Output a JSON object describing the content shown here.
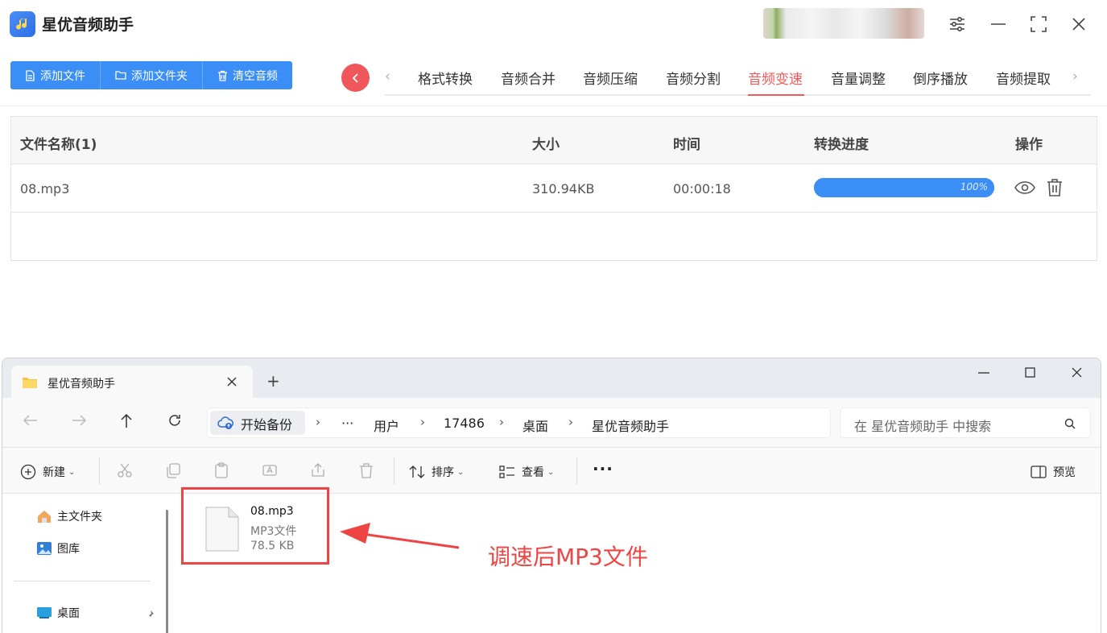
{
  "app": {
    "title": "星优音频助手",
    "accent": "#3a8ef6",
    "tab_accent": "#f05a5a"
  },
  "toolbar": {
    "add_file": "添加文件",
    "add_folder": "添加文件夹",
    "clear": "清空音频"
  },
  "tabs": {
    "items": [
      "格式转换",
      "音频合并",
      "音频压缩",
      "音频分割",
      "音频变速",
      "音量调整",
      "倒序播放",
      "音频提取"
    ],
    "active": "音频变速"
  },
  "table": {
    "headers": {
      "name": "文件名称(1)",
      "size": "大小",
      "time": "时间",
      "progress": "转换进度",
      "action": "操作"
    },
    "rows": [
      {
        "name": "08.mp3",
        "size": "310.94KB",
        "time": "00:00:18",
        "progress_label": "100%",
        "progress": 1.0
      }
    ]
  },
  "explorer": {
    "tab_title": "星优音频助手",
    "breadcrumb": {
      "backup": "开始备份",
      "more": "···",
      "items": [
        "用户",
        "17486",
        "桌面",
        "星优音频助手"
      ]
    },
    "search_placeholder": "在 星优音频助手 中搜索",
    "commands": {
      "new": "新建",
      "sort": "排序",
      "view": "查看",
      "more": "···",
      "preview": "预览"
    },
    "sidebar": {
      "home": "主文件夹",
      "gallery": "图库",
      "desktop": "桌面"
    },
    "file": {
      "name": "08.mp3",
      "type": "MP3文件",
      "size": "78.5 KB"
    }
  },
  "annotation": {
    "text": "调速后MP3文件",
    "color": "#ef4444"
  }
}
